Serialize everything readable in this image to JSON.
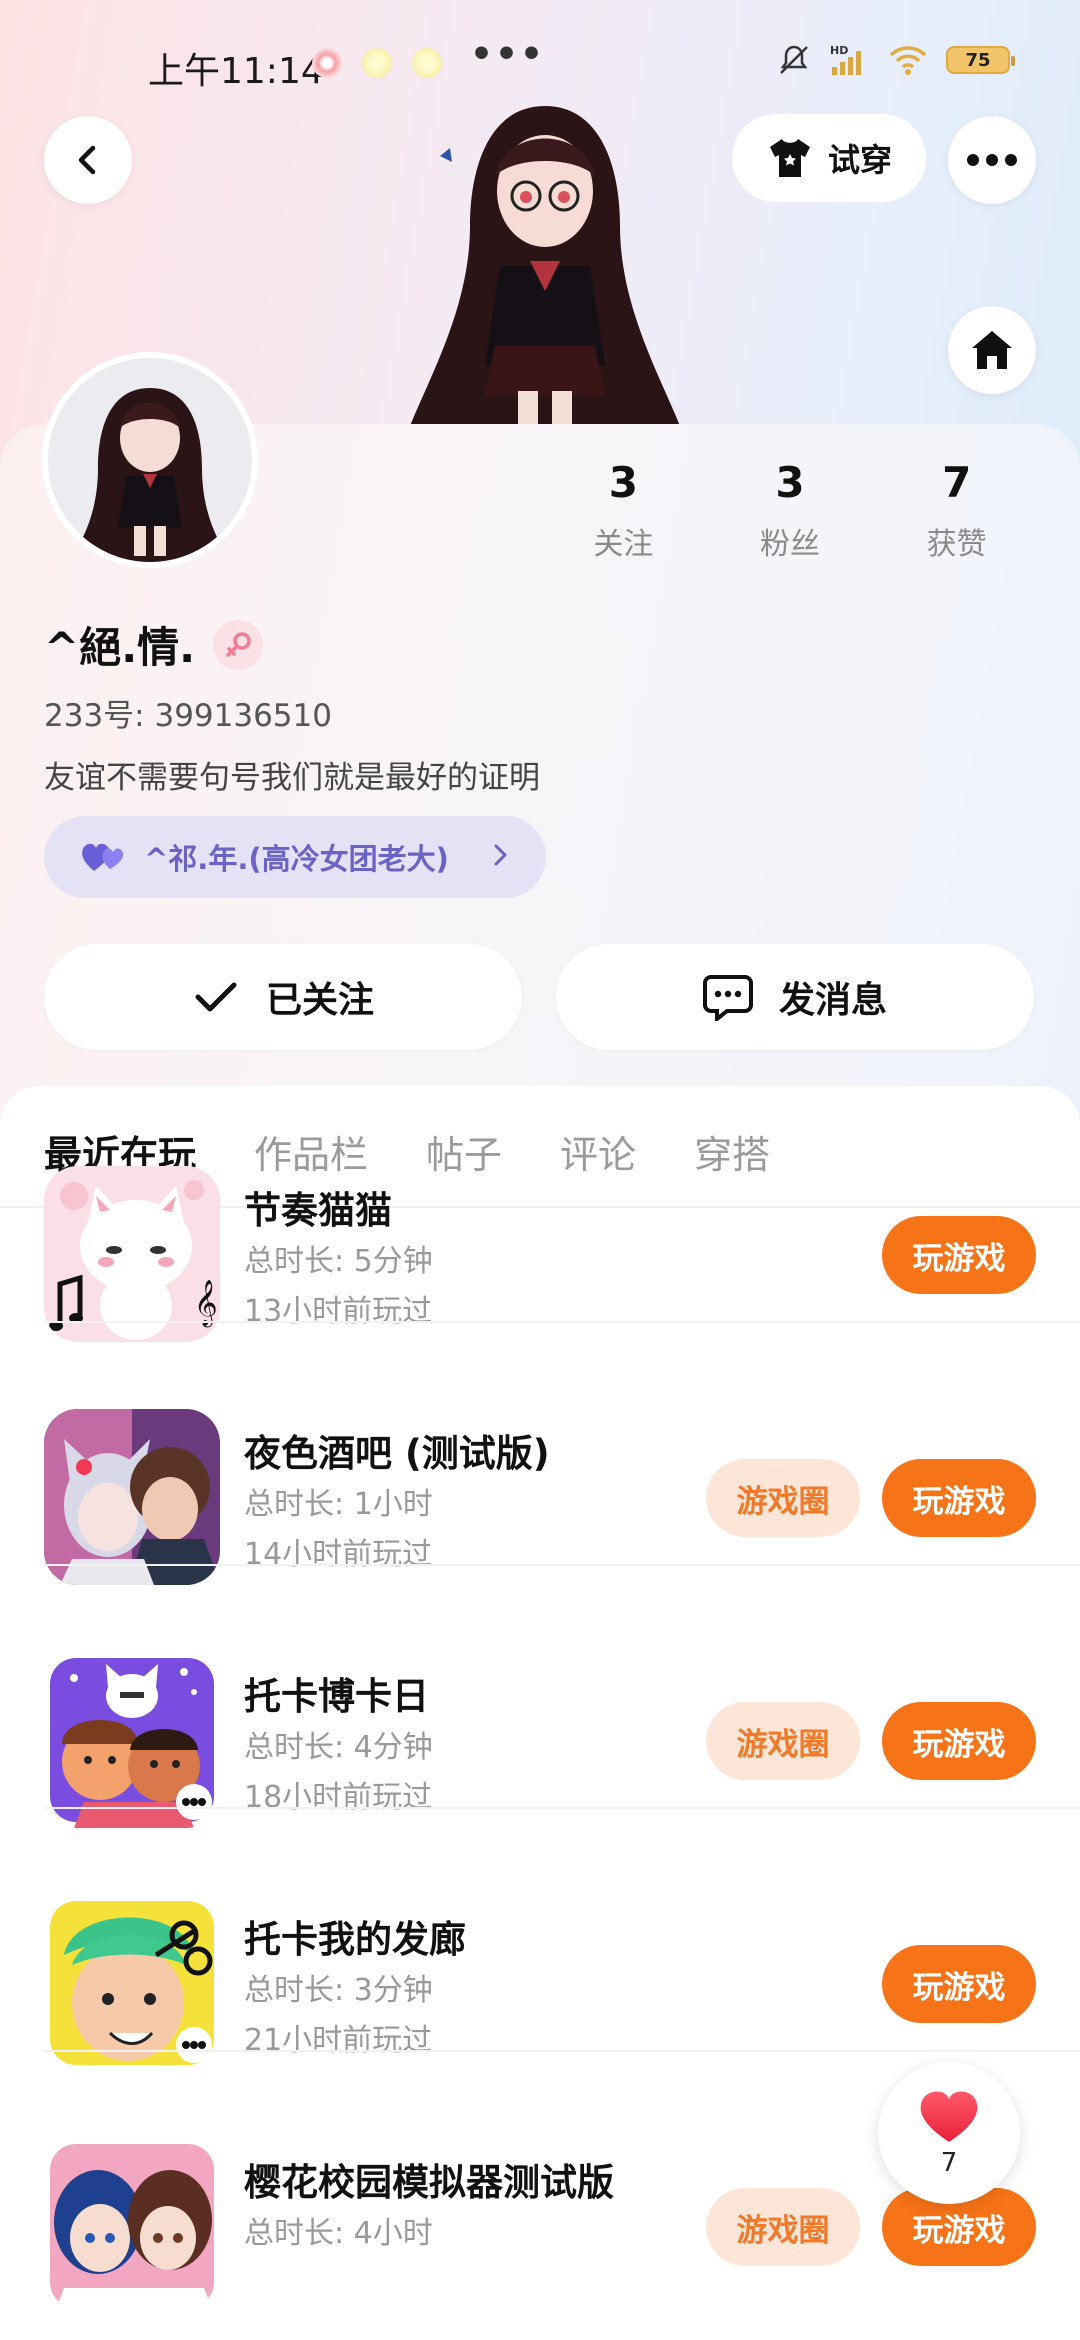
{
  "status_bar": {
    "time": "上午11:14",
    "more": "•••",
    "battery": "75"
  },
  "header": {
    "tryon_label": "试穿"
  },
  "profile": {
    "nickname": "^絕.情.",
    "uid": "233号: 399136510",
    "bio": "友谊不需要句号我们就是最好的证明",
    "relation": "^祁.年.(高冷女团老大)",
    "stats": [
      {
        "value": "3",
        "label": "关注"
      },
      {
        "value": "3",
        "label": "粉丝"
      },
      {
        "value": "7",
        "label": "获赞"
      }
    ],
    "follow_label": "已关注",
    "message_label": "发消息"
  },
  "tabs": [
    "最近在玩",
    "作品栏",
    "帖子",
    "评论",
    "穿搭"
  ],
  "games": [
    {
      "title": "节奏猫猫",
      "duration": "总时长: 5分钟",
      "last": "13小时前玩过",
      "circle": "",
      "play": "玩游戏"
    },
    {
      "title": "夜色酒吧 (测试版)",
      "duration": "总时长: 1小时",
      "last": "14小时前玩过",
      "circle": "游戏圈",
      "play": "玩游戏"
    },
    {
      "title": "托卡博卡日",
      "duration": "总时长: 4分钟",
      "last": "18小时前玩过",
      "circle": "游戏圈",
      "play": "玩游戏"
    },
    {
      "title": "托卡我的发廊",
      "duration": "总时长: 3分钟",
      "last": "21小时前玩过",
      "circle": "",
      "play": "玩游戏"
    },
    {
      "title": "樱花校园模拟器测试版",
      "duration": "总时长: 4小时",
      "last": "",
      "circle": "游戏圈",
      "play": "玩游戏"
    }
  ],
  "like_fab": {
    "count": "7"
  },
  "colors": {
    "accent": "#f77317",
    "circle_bg": "#fde6d8",
    "relation_bg": "#e5e2f6",
    "relation_text": "#6b62c6"
  }
}
